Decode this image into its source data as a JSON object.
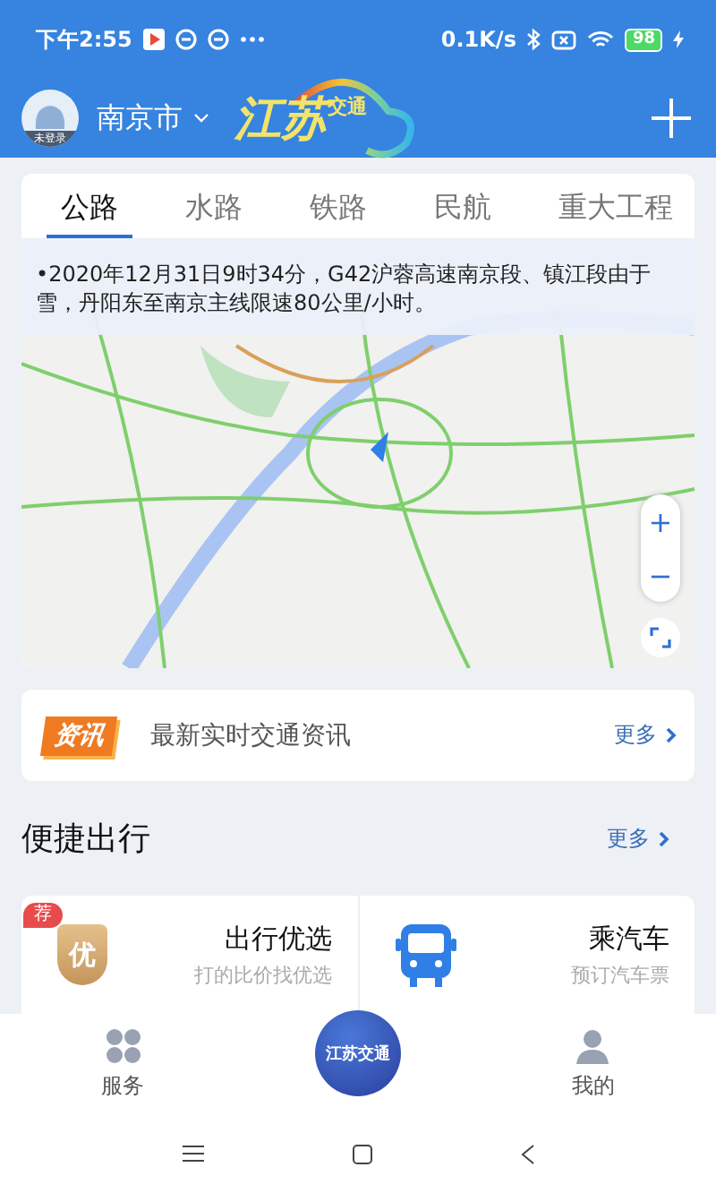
{
  "status_bar": {
    "time": "下午2:55",
    "speed": "0.1K/s",
    "battery": "98"
  },
  "header": {
    "avatar_label": "未登录",
    "city": "南京市",
    "logo_main": "江苏",
    "logo_sub": "交通"
  },
  "tabs": [
    {
      "label": "公路",
      "selected": true
    },
    {
      "label": "水路",
      "selected": false
    },
    {
      "label": "铁路",
      "selected": false
    },
    {
      "label": "民航",
      "selected": false
    },
    {
      "label": "重大工程",
      "selected": false
    }
  ],
  "map": {
    "notice": "•2020年12月31日9时34分，G42沪蓉高速南京段、镇江段由于雪，丹阳东至南京主线限速80公里/小时。",
    "zoom_in": "+",
    "zoom_out": "−"
  },
  "news": {
    "badge": "资讯",
    "text": "最新实时交通资讯",
    "more": "更多"
  },
  "quick": {
    "title": "便捷出行",
    "more": "更多",
    "items": [
      {
        "kind": "shield",
        "title": "出行优选",
        "subtitle": "打的比价找优选",
        "tag": "荐",
        "icon_text": "优"
      },
      {
        "kind": "bus",
        "title": "乘汽车",
        "subtitle": "预订汽车票"
      }
    ]
  },
  "bottom_nav": [
    {
      "kind": "grid",
      "label": "服务"
    },
    {
      "kind": "center",
      "label": "江苏交通"
    },
    {
      "kind": "person",
      "label": "我的"
    }
  ],
  "system_nav": [
    {
      "kind": "menu"
    },
    {
      "kind": "home"
    },
    {
      "kind": "back"
    }
  ]
}
